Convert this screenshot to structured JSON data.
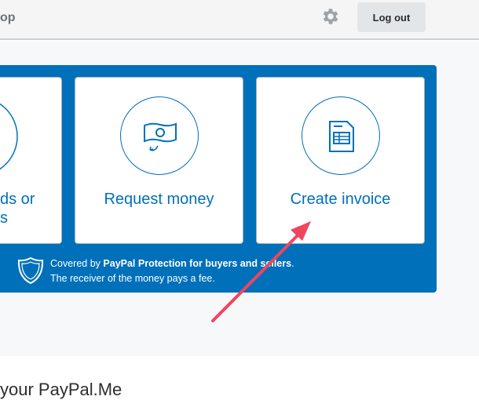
{
  "header": {
    "brand_fragment": "op",
    "logout_label": "Log out"
  },
  "cards": [
    {
      "label_line1": "ds or",
      "label_line2": "s"
    },
    {
      "label": "Request money"
    },
    {
      "label": "Create invoice"
    }
  ],
  "protection": {
    "prefix": "Covered by ",
    "bold": "PayPal Protection for buyers and sellers",
    "suffix": ".",
    "line2": "The receiver of the money pays a fee."
  },
  "section_title": "your PayPal.Me",
  "colors": {
    "brand_blue": "#0070ba",
    "arrow": "#f0455f"
  }
}
